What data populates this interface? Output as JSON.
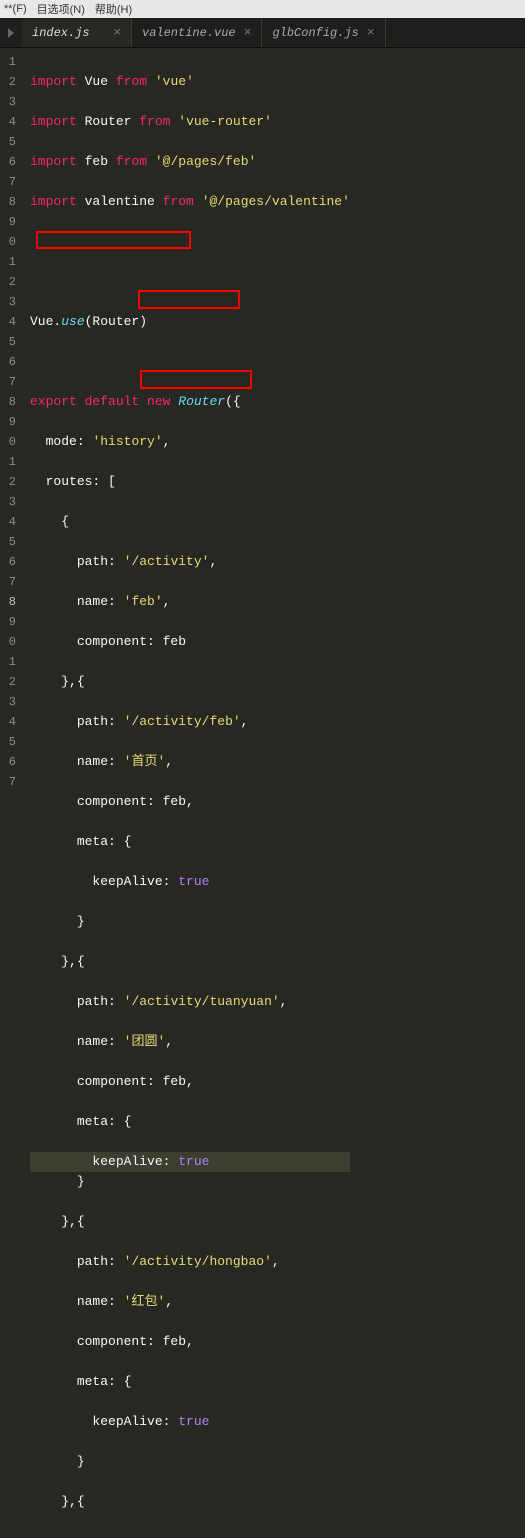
{
  "menubar": {
    "item1": "**(F)",
    "item2": "目选项(N)",
    "item3": "帮助(H)"
  },
  "tabs": [
    {
      "label": "index.js",
      "active": true,
      "close": "×"
    },
    {
      "label": "valentine.vue",
      "active": false,
      "close": "×"
    },
    {
      "label": "glbConfig.js",
      "active": false,
      "close": "×"
    }
  ],
  "lines": [
    "1",
    "2",
    "3",
    "4",
    "5",
    "6",
    "7",
    "8",
    "9",
    "0",
    "1",
    "2",
    "3",
    "4",
    "5",
    "6",
    "7",
    "8",
    "9",
    "0",
    "1",
    "2",
    "3",
    "4",
    "5",
    "6",
    "7",
    "8",
    "9",
    "0",
    "1",
    "2",
    "3",
    "4",
    "5",
    "6",
    "7"
  ],
  "code": {
    "import": "import",
    "from": "from",
    "Vue": "Vue",
    "Router": "Router",
    "feb": "feb",
    "valentine": "valentine",
    "sVue": "'vue'",
    "sVueRouter": "'vue-router'",
    "sFeb": "'@/pages/feb'",
    "sValentine": "'@/pages/valentine'",
    "use": "use",
    "export": "export",
    "default": "default",
    "new": "new",
    "mode": "mode",
    "sHistory": "'history'",
    "routes": "routes",
    "path": "path",
    "name": "name",
    "component": "component",
    "meta": "meta",
    "keepAlive": "keepAlive",
    "true": "true",
    "sActivity": "'/activity'",
    "sFebName": "'feb'",
    "sActivityF": "'/activity/f",
    "sEb": "eb'",
    "sShouye": "'首页'",
    "sTuanyuan": "'/activity/tuanyuan'",
    "sTuanyuanCn": "'团圆'",
    "sHongbao": "'/activity/hongbao'",
    "sHongbaoCn": "'红包'"
  }
}
